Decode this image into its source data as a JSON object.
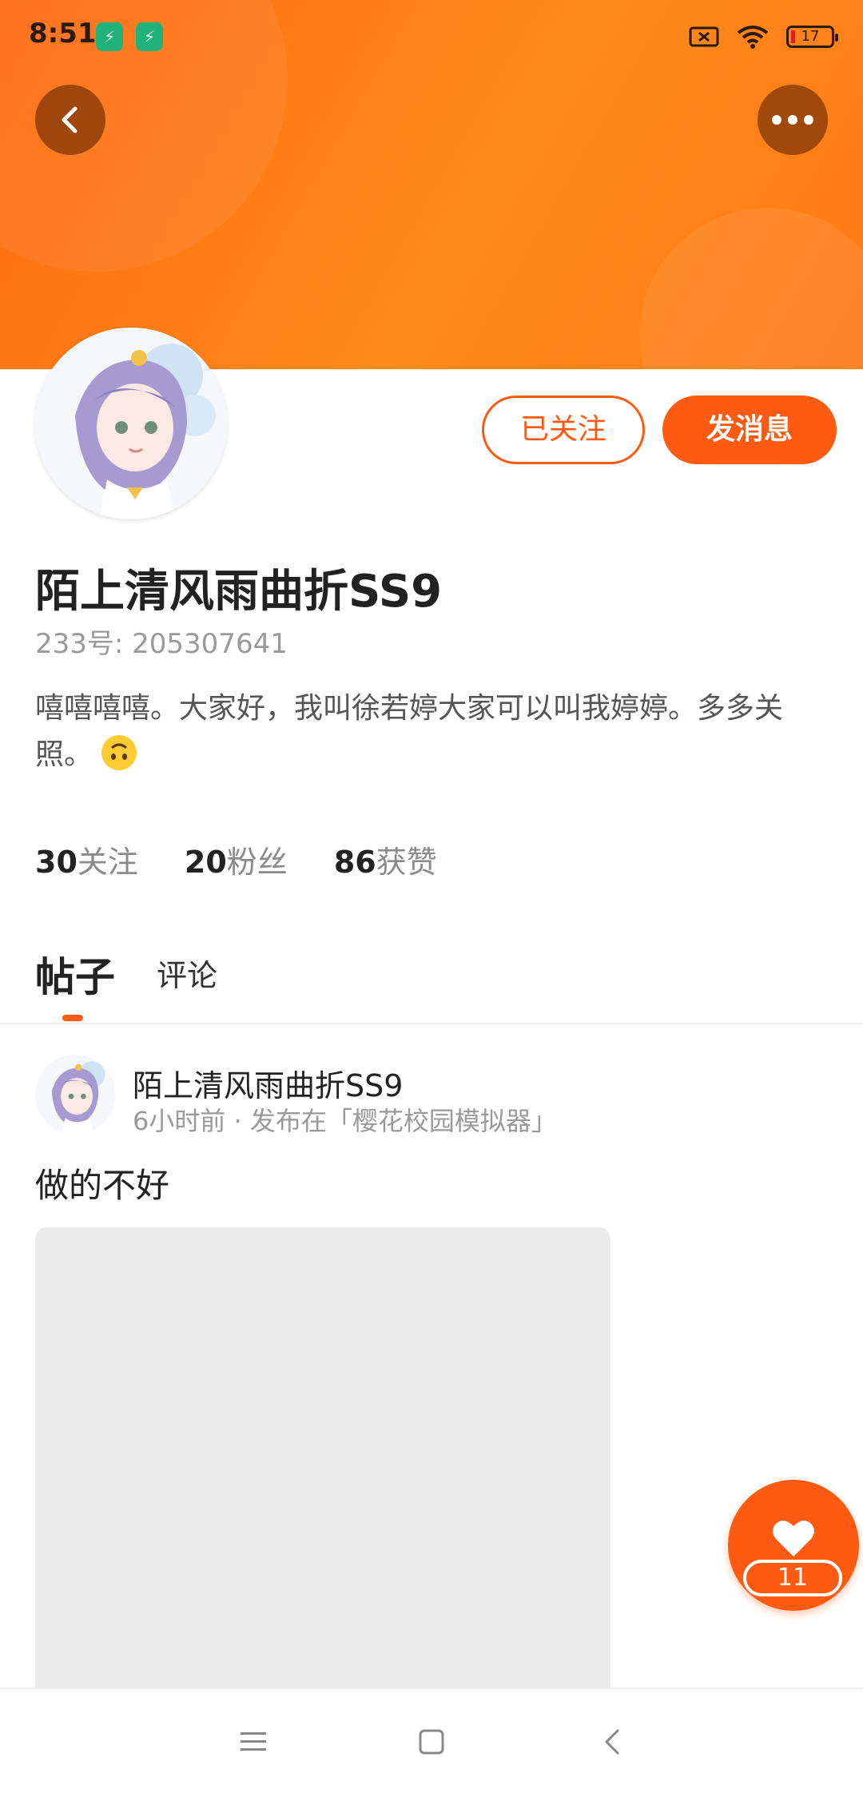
{
  "status_bar": {
    "time": "8:51",
    "battery": "17",
    "icons": [
      "shield-icon",
      "shield-icon",
      "sim-off-icon",
      "wifi-icon",
      "battery-icon"
    ]
  },
  "colors": {
    "accent": "#ff5a12",
    "banner_start": "#ff6a12",
    "banner_end": "#ff8a1a"
  },
  "header": {
    "back_icon": "chevron-left-icon",
    "more_icon": "more-horizontal-icon"
  },
  "profile": {
    "follow_label": "已关注",
    "message_label": "发消息",
    "username": "陌上清风雨曲折SS9",
    "user_id": "233号: 205307641",
    "bio": "嘻嘻嘻嘻。大家好，我叫徐若婷大家可以叫我婷婷。多多关照。",
    "stats": [
      {
        "num": "30",
        "label": "关注"
      },
      {
        "num": "20",
        "label": "粉丝"
      },
      {
        "num": "86",
        "label": "获赞"
      }
    ]
  },
  "tabs": {
    "posts": "帖子",
    "comments": "评论"
  },
  "post": {
    "author": "陌上清风雨曲折SS9",
    "meta": "6小时前 · 发布在「樱花校园模拟器」",
    "text": "做的不好"
  },
  "like": {
    "icon": "heart-icon",
    "count": "11"
  },
  "bottom_nav": {
    "icons": [
      "menu-icon",
      "home-square-icon",
      "back-triangle-icon"
    ]
  }
}
